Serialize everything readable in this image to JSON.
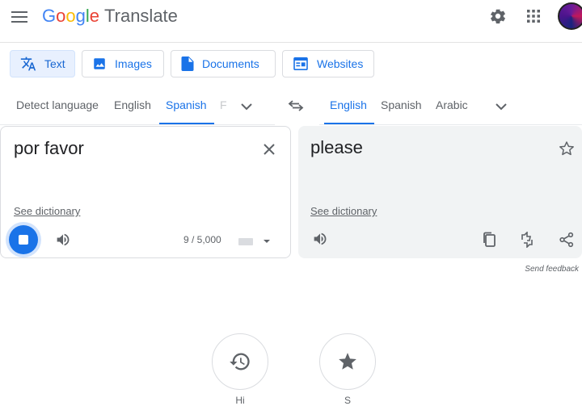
{
  "header": {
    "logo": {
      "letters": [
        "G",
        "o",
        "o",
        "g",
        "l",
        "e"
      ],
      "product": "Translate"
    }
  },
  "modes": [
    {
      "label": "Text"
    },
    {
      "label": "Images"
    },
    {
      "label": "Documents"
    },
    {
      "label": "Websites"
    }
  ],
  "source_langs": [
    {
      "label": "Detect language"
    },
    {
      "label": "English"
    },
    {
      "label": "Spanish"
    },
    {
      "label": "F"
    }
  ],
  "target_langs": [
    {
      "label": "English"
    },
    {
      "label": "Spanish"
    },
    {
      "label": "Arabic"
    }
  ],
  "source": {
    "text": "por favor",
    "dictionary_link": "See dictionary",
    "char_count": "9 / 5,000"
  },
  "target": {
    "text": "please",
    "dictionary_link": "See dictionary"
  },
  "feedback_label": "Send feedback",
  "bottom": {
    "history_label": "Hi",
    "saved_label": "S"
  },
  "colors": {
    "accent": "#1a73e8",
    "active_mode_bg": "#e8f0fe",
    "target_panel_bg": "#f1f3f4"
  }
}
